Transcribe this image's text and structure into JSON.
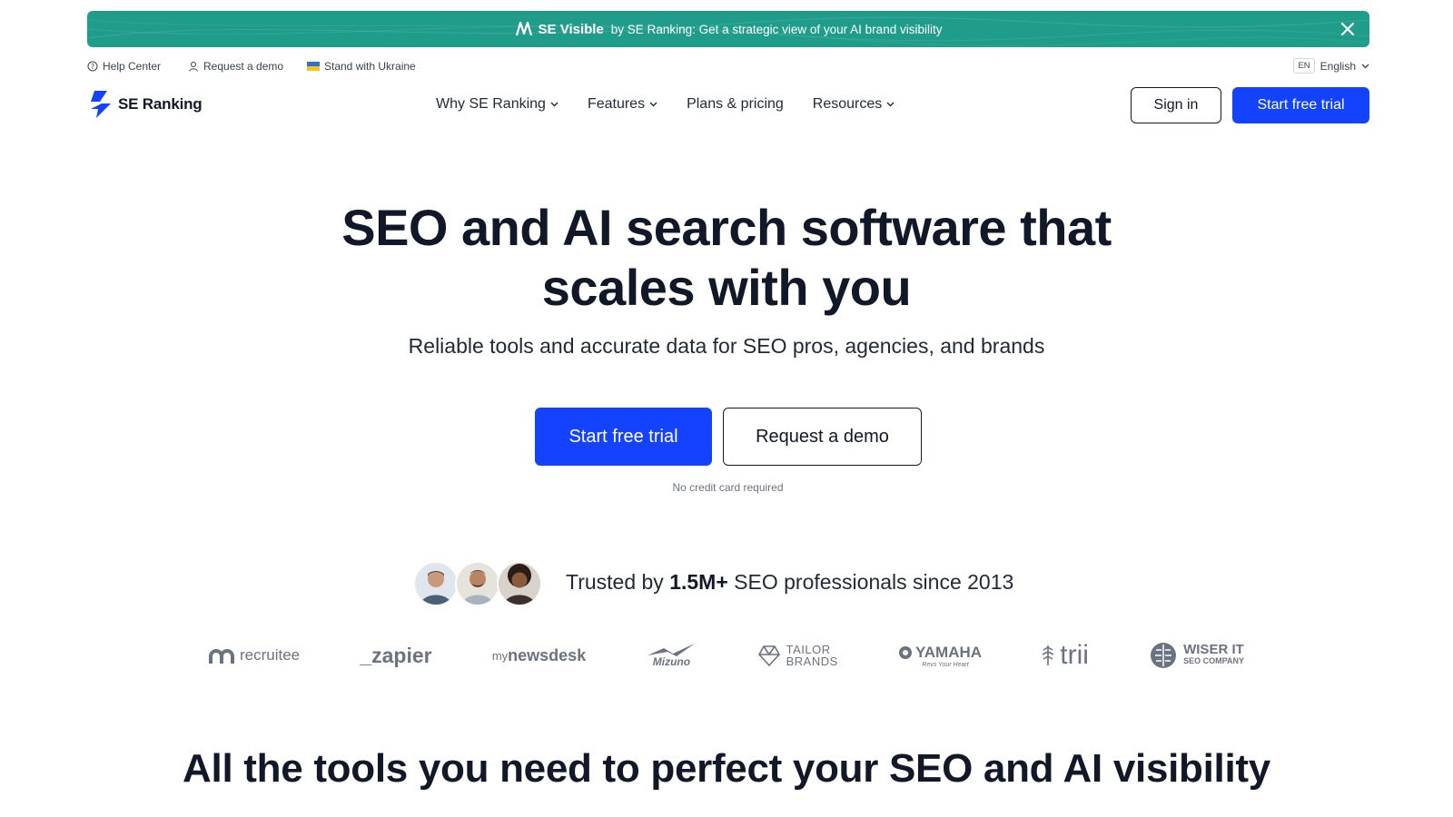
{
  "banner": {
    "brand": "SE Visible",
    "message": "by SE Ranking: Get a strategic view of your AI brand visibility",
    "background": "#1f9c8a",
    "close_icon": "close-icon"
  },
  "utility": {
    "help": "Help Center",
    "demo": "Request a demo",
    "ukraine": "Stand with Ukraine",
    "lang_code": "EN",
    "lang_name": "English"
  },
  "header": {
    "logo_text": "SE Ranking",
    "nav": [
      {
        "label": "Why SE Ranking",
        "has_dropdown": true
      },
      {
        "label": "Features",
        "has_dropdown": true
      },
      {
        "label": "Plans & pricing",
        "has_dropdown": false
      },
      {
        "label": "Resources",
        "has_dropdown": true
      }
    ],
    "sign_in": "Sign in",
    "start_trial": "Start free trial"
  },
  "hero": {
    "title_line1": "SEO and AI search software that",
    "title_line2": "scales with you",
    "subtitle": "Reliable tools and accurate data for SEO pros, agencies, and brands",
    "cta_primary": "Start free trial",
    "cta_secondary": "Request a demo",
    "note": "No credit card required"
  },
  "trust": {
    "prefix": "Trusted by",
    "highlight": "1.5M+",
    "suffix": "SEO professionals since 2013"
  },
  "client_logos": {
    "recruitee": "recruitee",
    "zapier": "_zapier",
    "mynewsdesk_my": "my",
    "mynewsdesk_main": "newsdesk",
    "mizuno": "Mizuno",
    "tailor_1": "TAILOR",
    "tailor_2": "BRANDS",
    "yamaha_1": "YAMAHA",
    "yamaha_2": "Revs Your Heart",
    "trii": "trii",
    "wiser_1": "WISER IT",
    "wiser_2": "SEO COMPANY"
  },
  "section": {
    "title": "All the tools you need to perfect your SEO and AI visibility"
  },
  "colors": {
    "primary": "#1443ff",
    "text": "#111827",
    "banner": "#1f9c8a"
  }
}
